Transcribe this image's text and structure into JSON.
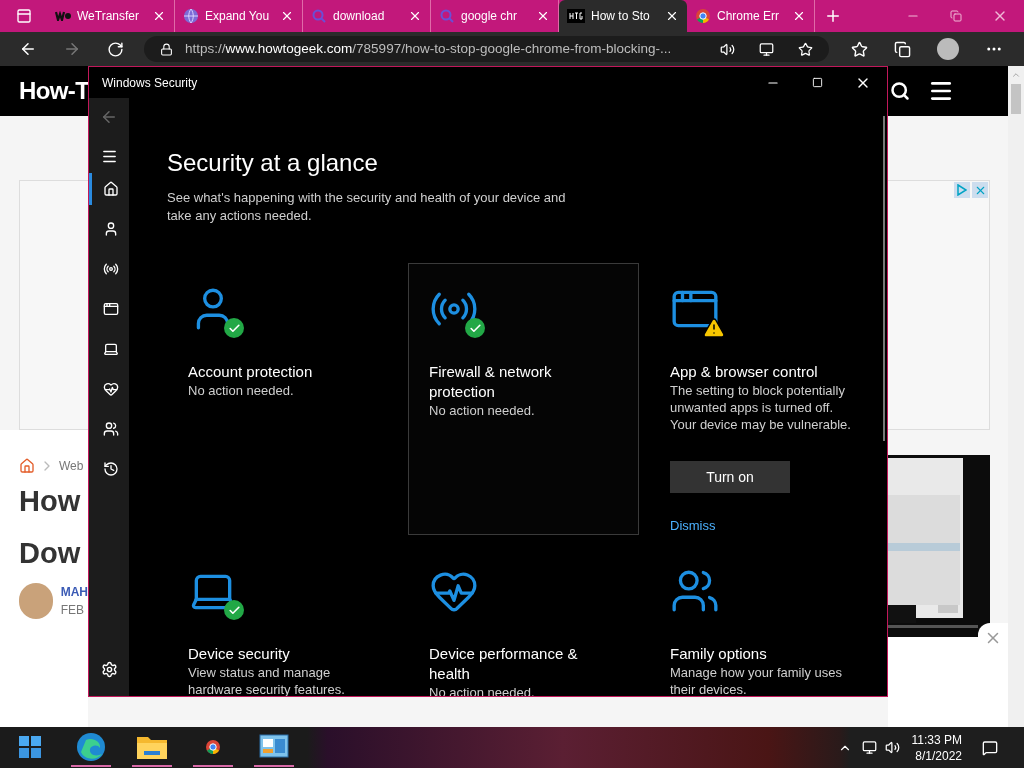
{
  "browser": {
    "tabs": [
      {
        "title": "WeTransfer",
        "kind": "wetransfer",
        "selected": false
      },
      {
        "title": "Expand You",
        "kind": "globe",
        "selected": false
      },
      {
        "title": "download",
        "kind": "search",
        "selected": false
      },
      {
        "title": "google chr",
        "kind": "search",
        "selected": false
      },
      {
        "title": "How to Sto",
        "kind": "htg",
        "selected": true
      },
      {
        "title": "Chrome Err",
        "kind": "chrome",
        "selected": false
      }
    ],
    "url": "https://**www.howtogeek.com**/785997/how-to-stop-google-chrome-from-blocking-...",
    "forward_disabled": true
  },
  "web": {
    "logo": "How-T",
    "breadcrumb": "Web",
    "headline_lines": [
      "How",
      "Dow"
    ],
    "author": "MAH",
    "date": "FEB"
  },
  "window": {
    "title": "Windows Security",
    "nav": [
      {
        "kind": "home",
        "selected": true
      },
      {
        "kind": "account",
        "selected": false
      },
      {
        "kind": "firewall",
        "selected": false
      },
      {
        "kind": "app",
        "selected": false
      },
      {
        "kind": "device",
        "selected": false
      },
      {
        "kind": "health",
        "selected": false
      },
      {
        "kind": "family",
        "selected": false
      },
      {
        "kind": "history",
        "selected": false
      }
    ],
    "heading": "Security at a glance",
    "description": "See what's happening with the security and health of your device and take any actions needed.",
    "cards": [
      {
        "kind": "account",
        "checked": true,
        "warning": false,
        "title": "Account protection",
        "text": "No action needed.",
        "selected": false
      },
      {
        "kind": "firewall",
        "checked": true,
        "warning": false,
        "title": "Firewall & network protection",
        "text": "No action needed.",
        "selected": true
      },
      {
        "kind": "app",
        "checked": false,
        "warning": true,
        "title": "App & browser control",
        "text": "The setting to block potentially unwanted apps is turned off. Your device may be vulnerable.",
        "button": "Turn on",
        "link": "Dismiss",
        "selected": false
      },
      {
        "kind": "device",
        "checked": true,
        "warning": false,
        "title": "Device security",
        "text": "View status and manage hardware security features.",
        "selected": false
      },
      {
        "kind": "health",
        "checked": false,
        "warning": false,
        "title": "Device performance & health",
        "text": "No action needed.",
        "selected": false
      },
      {
        "kind": "family",
        "checked": false,
        "warning": false,
        "title": "Family options",
        "text": "Manage how your family uses their devices.",
        "selected": false
      }
    ]
  },
  "taskbar": {
    "apps": [
      {
        "kind": "start",
        "running": false
      },
      {
        "kind": "edge",
        "running": true
      },
      {
        "kind": "explorer",
        "running": true
      },
      {
        "kind": "chrome",
        "running": true
      },
      {
        "kind": "control",
        "running": true
      }
    ],
    "time": "11:33 PM",
    "date": "8/1/2022"
  }
}
